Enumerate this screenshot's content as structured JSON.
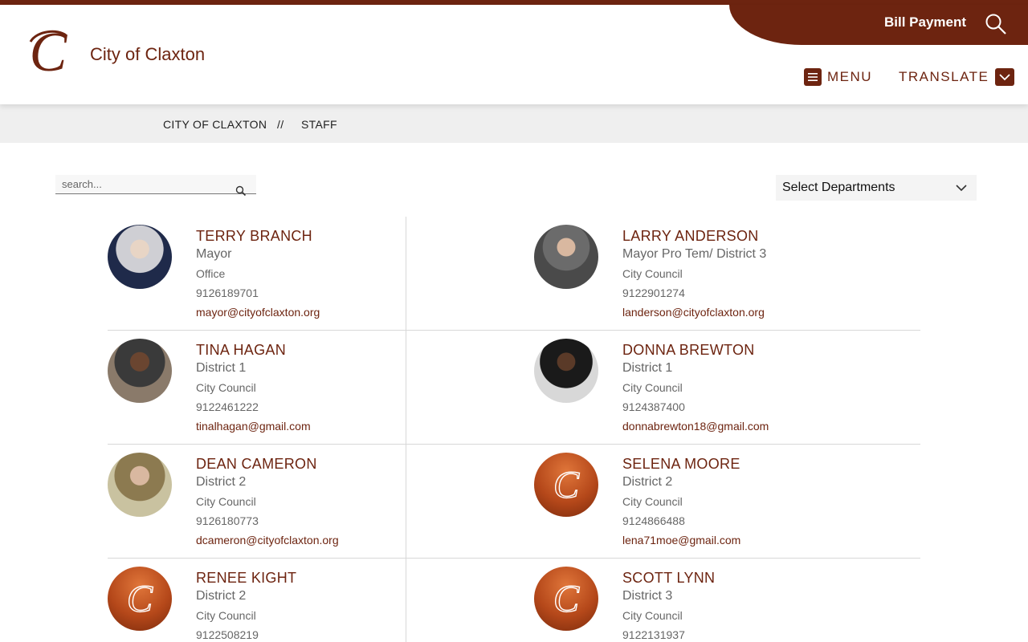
{
  "header": {
    "site_name": "City of Claxton",
    "bill_payment": "Bill Payment",
    "menu_label": "MENU",
    "translate_label": "TRANSLATE",
    "brand_color": "#6d2410"
  },
  "breadcrumb": {
    "home": "CITY OF CLAXTON",
    "separator": "//",
    "current": "STAFF"
  },
  "tools": {
    "search_placeholder": "search...",
    "dept_select": "Select Departments"
  },
  "staff": [
    {
      "name": "TERRY BRANCH",
      "title": "Mayor",
      "dept": "Office",
      "phone": "9126189701",
      "email": "mayor@cityofclaxton.org",
      "photo": "photo"
    },
    {
      "name": "LARRY ANDERSON",
      "title": "Mayor Pro Tem/ District 3",
      "dept": "City Council",
      "phone": "9122901274",
      "email": "landerson@cityofclaxton.org",
      "photo": "photo"
    },
    {
      "name": "TINA HAGAN",
      "title": "District 1",
      "dept": "City Council",
      "phone": "9122461222",
      "email": "tinalhagan@gmail.com",
      "photo": "photo"
    },
    {
      "name": "DONNA BREWTON",
      "title": "District 1",
      "dept": "City Council",
      "phone": "9124387400",
      "email": "donnabrewton18@gmail.com",
      "photo": "photo"
    },
    {
      "name": "DEAN CAMERON",
      "title": "District 2",
      "dept": "City Council",
      "phone": "9126180773",
      "email": "dcameron@cityofclaxton.org",
      "photo": "photo"
    },
    {
      "name": "SELENA MOORE",
      "title": "District 2",
      "dept": "City Council",
      "phone": "9124866488",
      "email": "lena71moe@gmail.com",
      "photo": "logo"
    },
    {
      "name": "RENEE KIGHT",
      "title": "District 2",
      "dept": "City Council",
      "phone": "9122508219",
      "email": "",
      "photo": "logo"
    },
    {
      "name": "SCOTT LYNN",
      "title": "District 3",
      "dept": "City Council",
      "phone": "9122131937",
      "email": "",
      "photo": "logo"
    }
  ]
}
